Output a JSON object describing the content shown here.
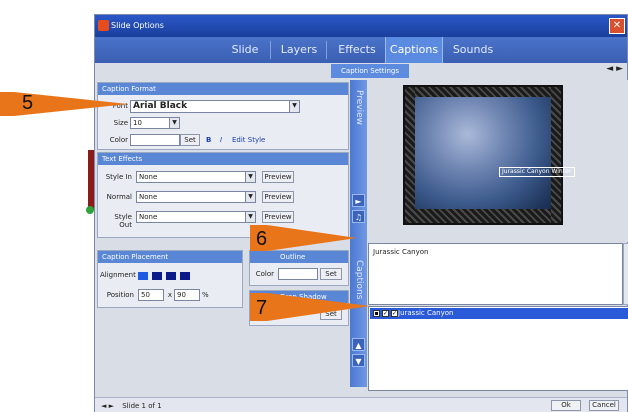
{
  "window": {
    "title": "Slide Options",
    "close_label": "✕"
  },
  "tabs": [
    {
      "label": "Slide"
    },
    {
      "label": "Layers"
    },
    {
      "label": "Effects"
    },
    {
      "label": "Captions"
    },
    {
      "label": "Sounds"
    }
  ],
  "active_tab": "Captions",
  "subtab": {
    "label": "Caption Settings"
  },
  "nav_arrows": "◄ ►",
  "caption_format": {
    "header": "Caption Format",
    "font_label": "Font",
    "font_value": "Arial Black",
    "size_label": "Size",
    "size_value": "10",
    "color_label": "Color",
    "set_label": "Set",
    "bold_label": "B",
    "italic_label": "I",
    "edit_style_label": "Edit Style"
  },
  "text_effects": {
    "header": "Text Effects",
    "rows": [
      {
        "label": "Style In",
        "value": "None",
        "button": "Preview"
      },
      {
        "label": "Normal",
        "value": "None",
        "button": "Preview"
      },
      {
        "label": "Style Out",
        "value": "None",
        "button": "Preview"
      }
    ]
  },
  "caption_placement": {
    "header": "Caption Placement",
    "alignment_label": "Alignment",
    "position_label": "Position",
    "position_x": "50",
    "position_y": "90"
  },
  "outline": {
    "header": "Outline",
    "color_label": "Color",
    "set_label": "Set"
  },
  "drop_shadow": {
    "header": "Drop Shadow",
    "set_label": "Set"
  },
  "side_strip": {
    "preview_label": "Preview",
    "captions_label": "Captions",
    "buttons": [
      "►",
      "♫",
      "▲",
      "▼"
    ]
  },
  "slide_caption_text": "Jurassic Canyon Winter",
  "caption_text_area": "Jurassic Canyon",
  "caption_list": [
    {
      "label": "Jurassic Canyon",
      "checked": true
    }
  ],
  "status_text": "Slide 1 of 1",
  "footer": {
    "ok_label": "Ok",
    "cancel_label": "Cancel"
  },
  "callouts": [
    {
      "label": "5"
    },
    {
      "label": "6"
    },
    {
      "label": "7"
    }
  ],
  "colors": {
    "title_bar": "#2b58c8",
    "tab_bar": "#4a73c9",
    "panel_header": "#5a86d6",
    "callout_arrow": "#e8751a",
    "selection": "#2a5ad8"
  }
}
